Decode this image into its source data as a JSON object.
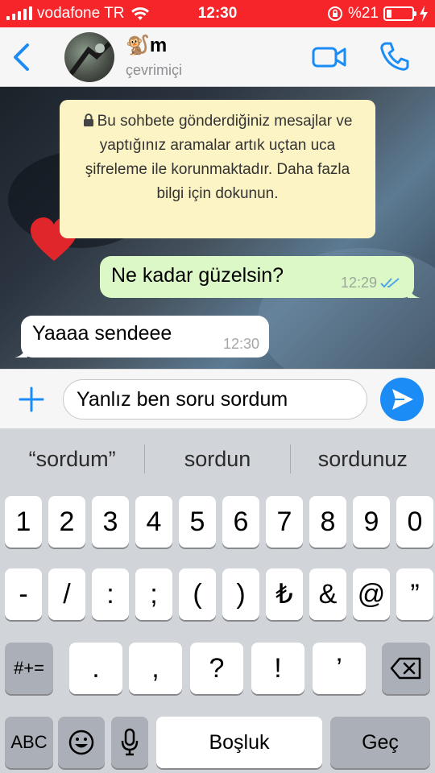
{
  "status_bar": {
    "carrier": "vodafone TR",
    "time": "12:30",
    "battery": "%21",
    "battery_level": 0.21
  },
  "header": {
    "contact_name": "🐒m",
    "contact_status": "çevrimiçi"
  },
  "chat": {
    "encryption_notice": "Bu sohbete gönderdiğiniz mesajlar ve yaptığınız aramalar artık uçtan uca şifreleme ile korunmaktadır. Daha fazla bilgi için dokunun.",
    "messages": [
      {
        "direction": "outgoing",
        "text": "Ne kadar güzelsin?",
        "time": "12:29",
        "status": "read"
      },
      {
        "direction": "incoming",
        "text": "Yaaaa sendeee",
        "time": "12:30"
      }
    ]
  },
  "composer": {
    "value": "Yanlız ben soru sordum"
  },
  "suggestions": [
    "“sordum”",
    "sordun",
    "sordunuz"
  ],
  "keyboard": {
    "row1": [
      "1",
      "2",
      "3",
      "4",
      "5",
      "6",
      "7",
      "8",
      "9",
      "0"
    ],
    "row2": [
      "-",
      "/",
      ":",
      ";",
      "(",
      ")",
      "₺",
      "&",
      "@",
      "”"
    ],
    "row3": [
      "#+=",
      ".",
      ",",
      "?",
      "!",
      "’"
    ],
    "space_label": "Boşluk",
    "return_label": "Geç",
    "abc_label": "ABC"
  },
  "colors": {
    "status_bar": "#f6252a",
    "accent": "#1b8cf5",
    "outgoing_bubble": "#dcf8c6",
    "notice_bg": "#fdf4c5"
  }
}
